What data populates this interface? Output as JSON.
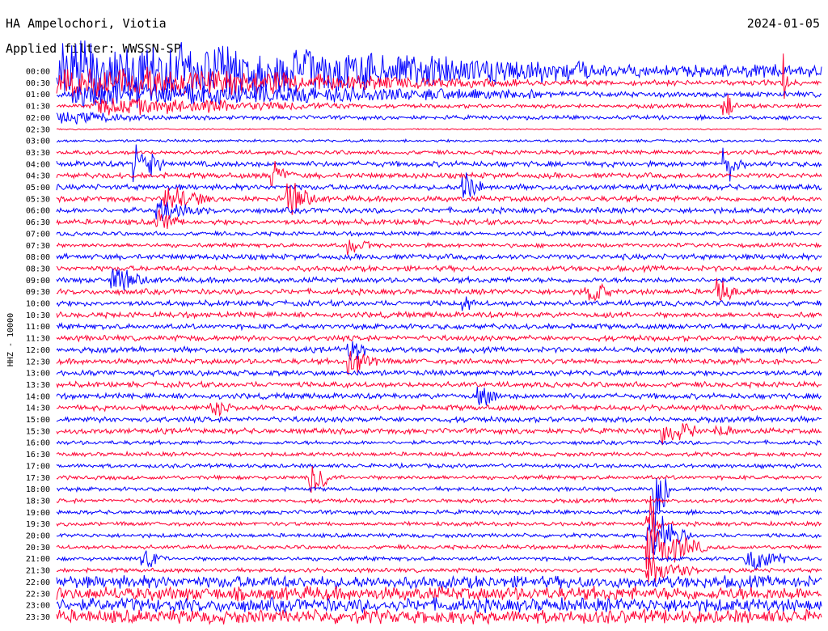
{
  "header": {
    "station": "HA Ampelochori, Viotia",
    "date": "2024-01-05",
    "filter": "Applied filter: WWSSN-SP"
  },
  "chart_data": {
    "type": "line",
    "title": "HA Ampelochori, Viotia",
    "ylabel": "HHZ - 10000",
    "colors": [
      "#0000ff",
      "#ff0033"
    ],
    "row_labels": [
      "00:00",
      "00:30",
      "01:00",
      "01:30",
      "02:00",
      "02:30",
      "03:00",
      "03:30",
      "04:00",
      "04:30",
      "05:00",
      "05:30",
      "06:00",
      "06:30",
      "07:00",
      "07:30",
      "08:00",
      "08:30",
      "09:00",
      "09:30",
      "10:00",
      "10:30",
      "11:00",
      "11:30",
      "12:00",
      "12:30",
      "13:00",
      "13:30",
      "14:00",
      "14:30",
      "15:00",
      "15:30",
      "16:00",
      "16:30",
      "17:00",
      "17:30",
      "18:00",
      "18:30",
      "19:00",
      "19:30",
      "20:00",
      "20:30",
      "21:00",
      "21:30",
      "22:00",
      "22:30",
      "23:00",
      "23:30"
    ],
    "row_amplitude": [
      9,
      4,
      4,
      3,
      3,
      1,
      2,
      3,
      4,
      4,
      4,
      4,
      4,
      4,
      3,
      3,
      4,
      4,
      4,
      4,
      4,
      4,
      4,
      4,
      4,
      4,
      4,
      4,
      4,
      4,
      4,
      4,
      3,
      3,
      3,
      3,
      3,
      3,
      3,
      3,
      3,
      3,
      3,
      3,
      9,
      10,
      10,
      10
    ],
    "events": [
      [
        0,
        0.0,
        0.7,
        40
      ],
      [
        1,
        0.0,
        0.6,
        18
      ],
      [
        2,
        0.02,
        0.62,
        16
      ],
      [
        3,
        0.05,
        0.35,
        10
      ],
      [
        4,
        0.0,
        0.15,
        6
      ],
      [
        3,
        0.87,
        0.02,
        18
      ],
      [
        1,
        0.95,
        0.01,
        40
      ],
      [
        8,
        0.1,
        0.04,
        30
      ],
      [
        9,
        0.28,
        0.03,
        18
      ],
      [
        10,
        0.53,
        0.03,
        22
      ],
      [
        11,
        0.14,
        0.06,
        18
      ],
      [
        11,
        0.3,
        0.04,
        20
      ],
      [
        12,
        0.13,
        0.07,
        14
      ],
      [
        13,
        0.13,
        0.03,
        18
      ],
      [
        8,
        0.87,
        0.03,
        24
      ],
      [
        15,
        0.38,
        0.04,
        14
      ],
      [
        18,
        0.07,
        0.05,
        14
      ],
      [
        19,
        0.69,
        0.04,
        16
      ],
      [
        19,
        0.86,
        0.03,
        20
      ],
      [
        20,
        0.53,
        0.02,
        10
      ],
      [
        24,
        0.38,
        0.03,
        16
      ],
      [
        25,
        0.38,
        0.04,
        20
      ],
      [
        28,
        0.55,
        0.04,
        12
      ],
      [
        29,
        0.2,
        0.03,
        10
      ],
      [
        31,
        0.79,
        0.05,
        18
      ],
      [
        31,
        0.86,
        0.03,
        10
      ],
      [
        35,
        0.33,
        0.03,
        30
      ],
      [
        36,
        0.78,
        0.02,
        90
      ],
      [
        39,
        0.77,
        0.02,
        40
      ],
      [
        40,
        0.77,
        0.06,
        30
      ],
      [
        41,
        0.77,
        0.08,
        30
      ],
      [
        42,
        0.11,
        0.03,
        14
      ],
      [
        42,
        0.9,
        0.06,
        16
      ],
      [
        43,
        0.77,
        0.07,
        22
      ]
    ]
  }
}
